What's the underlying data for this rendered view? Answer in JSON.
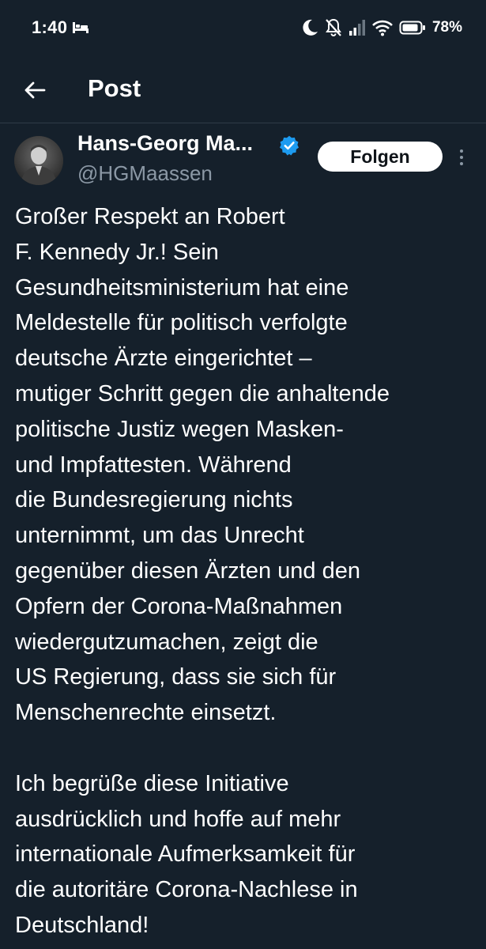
{
  "status_bar": {
    "time": "1:40",
    "battery": "78%",
    "icons": [
      "bed-icon",
      "moon-icon",
      "bell-off-icon",
      "signal-icon",
      "wifi-icon",
      "battery-icon"
    ]
  },
  "header": {
    "title": "Post",
    "back_icon": "arrow-left-icon"
  },
  "author": {
    "name": "Hans-Georg Ma...",
    "handle": "@HGMaassen",
    "verified": true,
    "follow_label": "Folgen",
    "more_icon": "more-vertical-icon"
  },
  "post": {
    "lines": [
      "Großer Respekt an Robert",
      "F. Kennedy Jr.! Sein",
      "Gesundheitsministerium hat eine",
      "Meldestelle für politisch verfolgte",
      "deutsche Ärzte eingerichtet –",
      "mutiger Schritt gegen die anhaltende",
      "politische Justiz wegen Masken-",
      "und Impfattesten. Während",
      "die Bundesregierung nichts",
      "unternimmt, um das Unrecht",
      "gegenüber diesen Ärzten und den",
      "Opfern der Corona-Maßnahmen",
      "wiedergutzumachen, zeigt die",
      "US Regierung, dass sie sich für",
      "Menschenrechte einsetzt.",
      "",
      "Ich begrüße diese Initiative",
      "ausdrücklich und hoffe auf mehr",
      "internationale Aufmerksamkeit für",
      "die autoritäre Corona-Nachlese in",
      "Deutschland!"
    ]
  },
  "colors": {
    "background": "#15202b",
    "text": "#ffffff",
    "secondary_text": "#8b98a5",
    "verified": "#1d9bf0",
    "follow_bg": "#ffffff",
    "follow_text": "#0f1419"
  }
}
